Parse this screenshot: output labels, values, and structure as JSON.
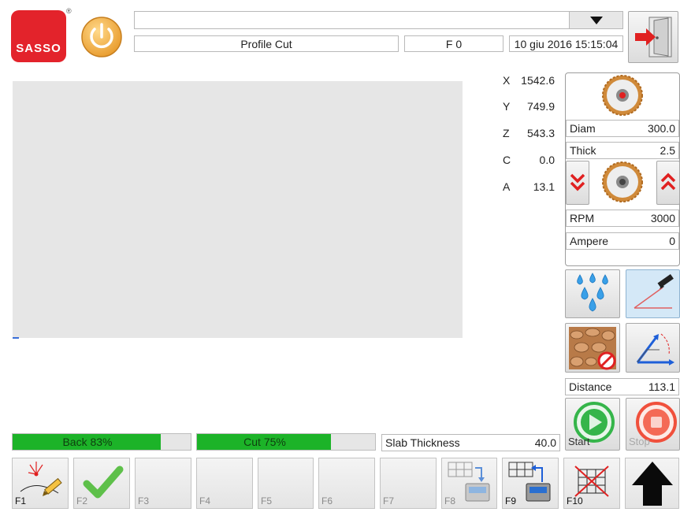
{
  "header": {
    "logo_text": "SASSO",
    "logo_mark": "®",
    "top_field_value": "",
    "mode_label": "Profile Cut",
    "feed_label": "F 0",
    "datetime": "10 giu 2016 15:15:04"
  },
  "coordinates": [
    {
      "axis": "X",
      "value": "1542.6"
    },
    {
      "axis": "Y",
      "value": "749.9"
    },
    {
      "axis": "Z",
      "value": "543.3"
    },
    {
      "axis": "C",
      "value": "0.0"
    },
    {
      "axis": "A",
      "value": "13.1"
    }
  ],
  "blade": {
    "diam_label": "Diam",
    "diam_value": "300.0",
    "thick_label": "Thick",
    "thick_value": "2.5",
    "rpm_label": "RPM",
    "rpm_value": "3000",
    "ampere_label": "Ampere",
    "ampere_value": "0"
  },
  "distance": {
    "label": "Distance",
    "value": "113.1"
  },
  "controls": {
    "start_label": "Start",
    "stop_label": "Stop"
  },
  "progress": {
    "back": {
      "label": "Back 83%",
      "level": 0.83
    },
    "cut": {
      "label": "Cut 75%",
      "level": 0.75
    }
  },
  "slab": {
    "label": "Slab Thickness",
    "value": "40.0"
  },
  "function_keys": [
    {
      "label": "F1",
      "icon": "laser-pencil-icon",
      "active": true
    },
    {
      "label": "F2",
      "icon": "checkmark-icon",
      "active": false
    },
    {
      "label": "F3",
      "icon": "",
      "active": false
    },
    {
      "label": "F4",
      "icon": "",
      "active": false
    },
    {
      "label": "F5",
      "icon": "",
      "active": false
    },
    {
      "label": "F6",
      "icon": "",
      "active": false
    },
    {
      "label": "F7",
      "icon": "",
      "active": false
    },
    {
      "label": "F8",
      "icon": "grid-arrow-down-icon",
      "active": false
    },
    {
      "label": "F9",
      "icon": "grid-arrow-up-icon",
      "active": true
    },
    {
      "label": "F10",
      "icon": "grid-cross-icon",
      "active": true
    }
  ],
  "colors": {
    "progress_fill": "#1cb328",
    "logo_red": "#e3232b",
    "power_orange": "#f2a93b",
    "chevron_red": "#e02020",
    "start_green": "#35b54a",
    "stop_red": "#f0503c"
  }
}
